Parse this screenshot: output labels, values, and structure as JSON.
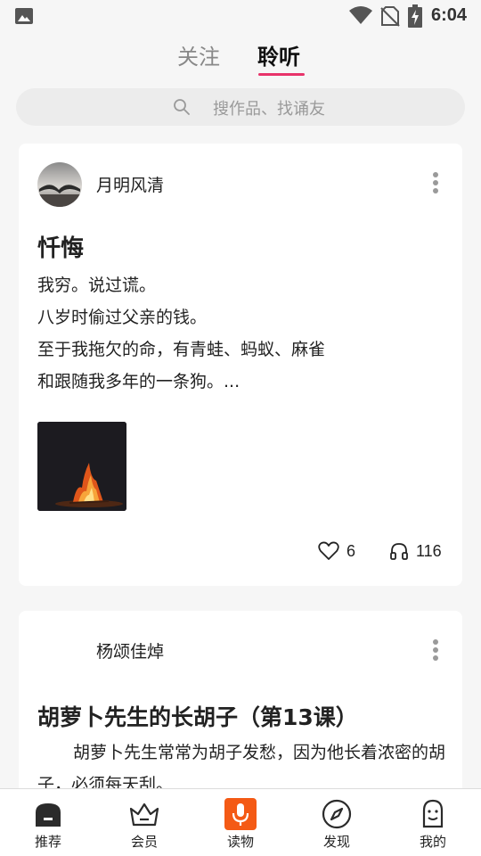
{
  "status_bar": {
    "time": "6:04"
  },
  "tabs": {
    "follow": "关注",
    "listen": "聆听"
  },
  "search": {
    "placeholder": "搜作品、找诵友"
  },
  "posts": [
    {
      "author": "月明风清",
      "title": "忏悔",
      "lines": [
        "我穷。说过谎。",
        "八岁时偷过父亲的钱。",
        "至于我拖欠的命，有青蛙、蚂蚁、麻雀",
        "和跟随我多年的一条狗。..."
      ],
      "likes": "6",
      "listens": "116"
    },
    {
      "author": "杨颂佳焯",
      "title": "胡萝卜先生的长胡子（第13课）",
      "body": "胡萝卜先生常常为胡子发愁，因为他长着浓密的胡子，必须每天刮。"
    }
  ],
  "bottom_nav": [
    {
      "label": "推荐",
      "icon": "home-icon"
    },
    {
      "label": "会员",
      "icon": "crown-icon"
    },
    {
      "label": "读物",
      "icon": "microphone-icon",
      "accent": "#f45a15"
    },
    {
      "label": "发现",
      "icon": "compass-icon"
    },
    {
      "label": "我的",
      "icon": "profile-icon"
    }
  ],
  "colors": {
    "tab_indicator": "#e8336a",
    "read_accent": "#f45a15",
    "background": "#f6f6f6"
  }
}
